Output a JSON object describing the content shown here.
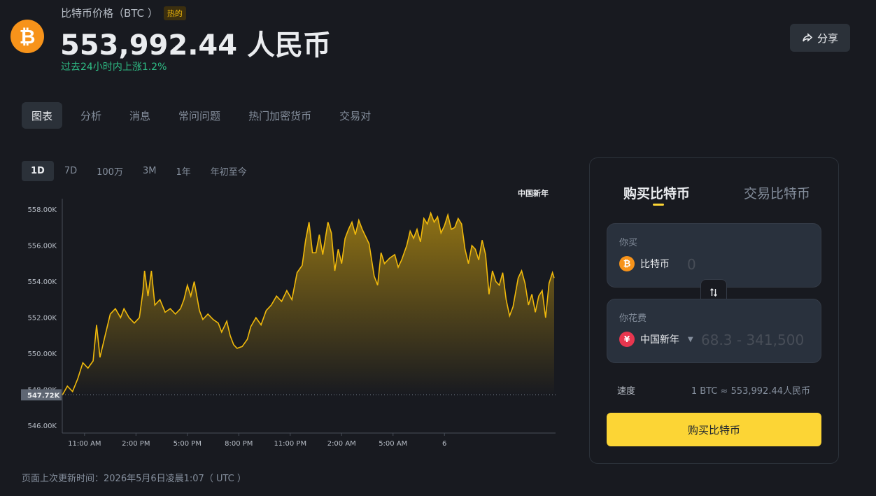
{
  "header": {
    "coin_symbol_glyph": "₿",
    "title": "比特币价格（BTC ）",
    "hot_badge": "热的",
    "price": "553,992.44 人民币",
    "change": "过去24小时内上涨1.2%",
    "share_label": "分享"
  },
  "tabs": [
    {
      "label": "图表",
      "active": true
    },
    {
      "label": "分析"
    },
    {
      "label": "消息"
    },
    {
      "label": "常问问题"
    },
    {
      "label": "热门加密货币"
    },
    {
      "label": "交易对"
    }
  ],
  "ranges": [
    {
      "label": "1D",
      "active": true
    },
    {
      "label": "7D"
    },
    {
      "label": "100万"
    },
    {
      "label": "3M"
    },
    {
      "label": "1年"
    },
    {
      "label": "年初至今"
    }
  ],
  "chart_data": {
    "type": "area",
    "legend_label": "中国新年",
    "y_ticks": [
      "558.00K",
      "556.00K",
      "554.00K",
      "552.00K",
      "550.00K",
      "548.00K",
      "546.00K"
    ],
    "ylim": [
      545600,
      558600
    ],
    "x_ticks": [
      {
        "label": "11:00 AM",
        "pos": 1.3
      },
      {
        "label": "2:00 PM",
        "pos": 4.3
      },
      {
        "label": "5:00 PM",
        "pos": 7.3
      },
      {
        "label": "8:00 PM",
        "pos": 10.3
      },
      {
        "label": "11:00 PM",
        "pos": 13.3
      },
      {
        "label": "2:00 AM",
        "pos": 16.3
      },
      {
        "label": "5:00 AM",
        "pos": 19.3
      },
      {
        "label": "6",
        "pos": 22.3
      }
    ],
    "x_range": [
      0,
      24
    ],
    "open_value": 547720,
    "open_label": "547.72K",
    "color": "#f0b90b",
    "points": [
      [
        0.0,
        547.7
      ],
      [
        0.3,
        548.2
      ],
      [
        0.6,
        547.9
      ],
      [
        0.9,
        548.6
      ],
      [
        1.2,
        549.5
      ],
      [
        1.5,
        549.2
      ],
      [
        1.8,
        549.6
      ],
      [
        2.0,
        551.6
      ],
      [
        2.2,
        549.8
      ],
      [
        2.5,
        551.0
      ],
      [
        2.8,
        552.2
      ],
      [
        3.1,
        552.5
      ],
      [
        3.4,
        552.0
      ],
      [
        3.6,
        552.5
      ],
      [
        3.9,
        552.0
      ],
      [
        4.2,
        551.7
      ],
      [
        4.5,
        552.0
      ],
      [
        4.7,
        553.4
      ],
      [
        4.8,
        554.6
      ],
      [
        5.0,
        553.2
      ],
      [
        5.2,
        554.6
      ],
      [
        5.4,
        552.7
      ],
      [
        5.7,
        553.0
      ],
      [
        6.0,
        552.3
      ],
      [
        6.3,
        552.5
      ],
      [
        6.6,
        552.2
      ],
      [
        6.9,
        552.5
      ],
      [
        7.1,
        553.0
      ],
      [
        7.3,
        553.8
      ],
      [
        7.5,
        553.2
      ],
      [
        7.7,
        554.0
      ],
      [
        8.0,
        552.4
      ],
      [
        8.2,
        551.9
      ],
      [
        8.5,
        552.2
      ],
      [
        8.8,
        551.9
      ],
      [
        9.1,
        551.7
      ],
      [
        9.3,
        551.2
      ],
      [
        9.6,
        551.8
      ],
      [
        9.8,
        551.0
      ],
      [
        10.0,
        550.5
      ],
      [
        10.2,
        550.3
      ],
      [
        10.5,
        550.4
      ],
      [
        10.8,
        550.8
      ],
      [
        11.0,
        551.5
      ],
      [
        11.3,
        552.0
      ],
      [
        11.6,
        551.6
      ],
      [
        11.9,
        552.4
      ],
      [
        12.2,
        552.7
      ],
      [
        12.5,
        553.2
      ],
      [
        12.8,
        552.9
      ],
      [
        13.1,
        553.5
      ],
      [
        13.4,
        553.0
      ],
      [
        13.7,
        554.5
      ],
      [
        14.0,
        554.9
      ],
      [
        14.2,
        556.3
      ],
      [
        14.4,
        557.3
      ],
      [
        14.6,
        555.6
      ],
      [
        14.8,
        555.6
      ],
      [
        15.0,
        556.6
      ],
      [
        15.2,
        555.5
      ],
      [
        15.5,
        557.3
      ],
      [
        15.7,
        556.7
      ],
      [
        15.9,
        554.6
      ],
      [
        16.1,
        555.8
      ],
      [
        16.3,
        555.0
      ],
      [
        16.5,
        556.4
      ],
      [
        16.7,
        556.9
      ],
      [
        16.9,
        557.3
      ],
      [
        17.1,
        556.6
      ],
      [
        17.3,
        557.4
      ],
      [
        17.5,
        556.9
      ],
      [
        17.7,
        556.5
      ],
      [
        17.9,
        556.1
      ],
      [
        18.2,
        554.3
      ],
      [
        18.4,
        553.8
      ],
      [
        18.6,
        555.6
      ],
      [
        18.8,
        555.0
      ],
      [
        19.1,
        555.3
      ],
      [
        19.4,
        555.5
      ],
      [
        19.6,
        554.8
      ],
      [
        19.8,
        555.2
      ],
      [
        20.1,
        556.0
      ],
      [
        20.3,
        556.8
      ],
      [
        20.5,
        556.4
      ],
      [
        20.7,
        556.9
      ],
      [
        20.9,
        556.2
      ],
      [
        21.1,
        557.5
      ],
      [
        21.3,
        557.2
      ],
      [
        21.5,
        557.8
      ],
      [
        21.7,
        557.3
      ],
      [
        21.9,
        557.6
      ],
      [
        22.1,
        556.7
      ],
      [
        22.3,
        557.1
      ],
      [
        22.5,
        557.7
      ],
      [
        22.7,
        556.9
      ],
      [
        22.9,
        557.0
      ],
      [
        23.1,
        557.5
      ],
      [
        23.3,
        557.2
      ],
      [
        23.5,
        555.8
      ],
      [
        23.7,
        555.0
      ],
      [
        23.9,
        556.0
      ],
      [
        24.1,
        555.8
      ],
      [
        24.3,
        555.2
      ],
      [
        24.5,
        556.3
      ],
      [
        24.7,
        555.5
      ],
      [
        24.9,
        553.3
      ],
      [
        25.1,
        554.6
      ],
      [
        25.3,
        554.0
      ],
      [
        25.5,
        553.8
      ],
      [
        25.7,
        554.5
      ],
      [
        25.9,
        553.0
      ],
      [
        26.1,
        552.1
      ],
      [
        26.3,
        552.6
      ],
      [
        26.6,
        554.2
      ],
      [
        26.8,
        554.6
      ],
      [
        27.0,
        553.9
      ],
      [
        27.2,
        552.7
      ],
      [
        27.4,
        553.3
      ],
      [
        27.6,
        552.3
      ],
      [
        27.8,
        553.2
      ],
      [
        28.0,
        553.5
      ],
      [
        28.2,
        552.0
      ],
      [
        28.4,
        553.9
      ],
      [
        28.6,
        554.5
      ],
      [
        28.7,
        554.2
      ]
    ]
  },
  "updated": "页面上次更新时间：2026年5月6日凌晨1:07（ UTC ）",
  "trade": {
    "tab_buy": "购买比特币",
    "tab_trade": "交易比特币",
    "buy_label": "你买",
    "buy_coin": "比特币",
    "buy_coin_glyph": "₿",
    "buy_placeholder": "0",
    "spend_label": "你花费",
    "spend_currency": "中国新年",
    "spend_currency_glyph": "¥",
    "spend_placeholder": "68.3 - 341,500",
    "rate_label": "速度",
    "rate_value": "1 BTC ≈ 553,992.44人民币",
    "buy_button": "购买比特币"
  },
  "icons": {
    "share": "share-icon",
    "swap": "swap-arrows-icon",
    "dropdown": "caret-down-icon"
  }
}
